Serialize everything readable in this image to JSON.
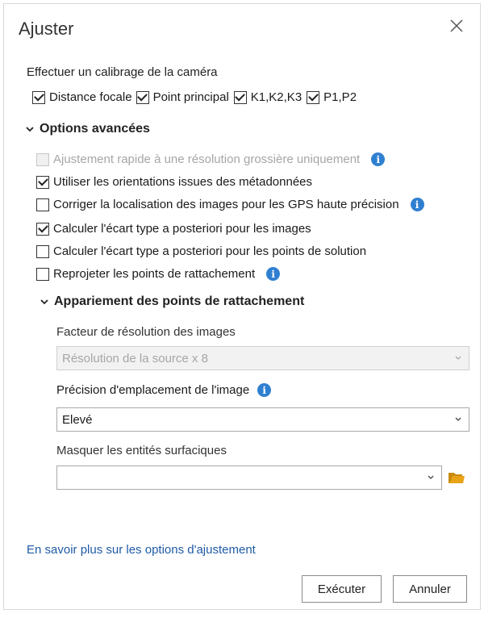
{
  "dialog": {
    "title": "Ajuster"
  },
  "calibration": {
    "label": "Effectuer un calibrage de la caméra",
    "options": [
      {
        "label": "Distance focale",
        "checked": true
      },
      {
        "label": "Point principal",
        "checked": true
      },
      {
        "label": "K1,K2,K3",
        "checked": true
      },
      {
        "label": "P1,P2",
        "checked": true
      }
    ]
  },
  "advanced": {
    "header": "Options avancées",
    "options": [
      {
        "label": "Ajustement rapide à une résolution grossière uniquement",
        "checked": false,
        "disabled": true,
        "info": true
      },
      {
        "label": "Utiliser les orientations issues des métadonnées",
        "checked": true,
        "disabled": false,
        "info": false
      },
      {
        "label": "Corriger la localisation des images pour les GPS haute précision",
        "checked": false,
        "disabled": false,
        "info": true
      },
      {
        "label": "Calculer l'écart type a posteriori pour les images",
        "checked": true,
        "disabled": false,
        "info": false
      },
      {
        "label": "Calculer l'écart type a posteriori pour les points de solution",
        "checked": false,
        "disabled": false,
        "info": false
      },
      {
        "label": "Reprojeter les points de rattachement",
        "checked": false,
        "disabled": false,
        "info": true
      }
    ]
  },
  "matching": {
    "header": "Appariement des points de rattachement",
    "resolution_label": "Facteur de résolution des images",
    "resolution_value": "Résolution de la source x 8",
    "precision_label": "Précision d'emplacement de l'image",
    "precision_value": "Elevé",
    "mask_label": "Masquer les entités surfaciques",
    "mask_value": ""
  },
  "footer": {
    "link": "En savoir plus sur les options d'ajustement",
    "run": "Exécuter",
    "cancel": "Annuler"
  },
  "colors": {
    "info": "#2f7fd1",
    "link": "#1f5aa6",
    "folder": "#e8a317"
  },
  "icons": {
    "close": "close-icon",
    "info": "info-icon",
    "chevron": "chevron-down-icon",
    "folder": "folder-icon"
  }
}
